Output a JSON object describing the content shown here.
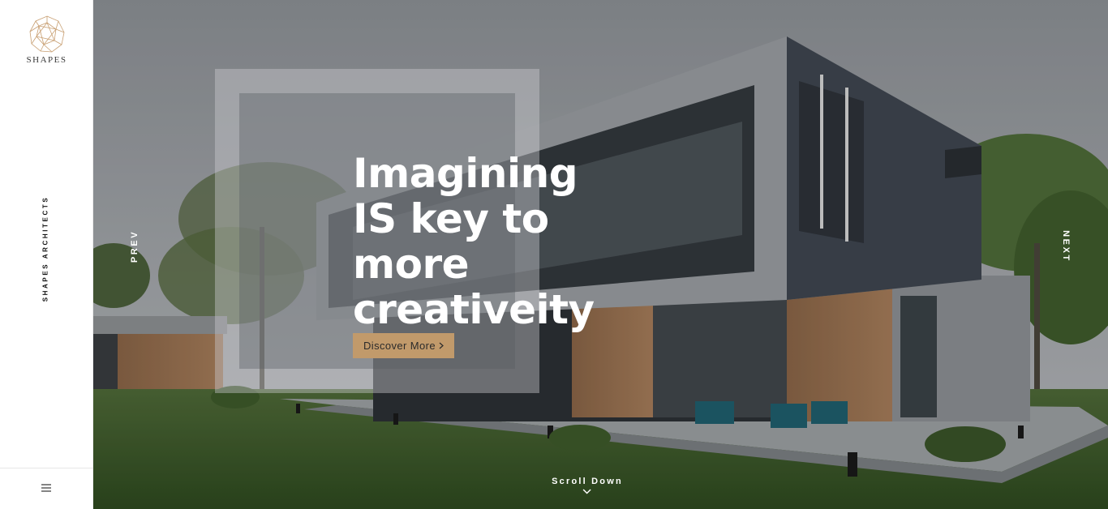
{
  "brand": {
    "logo_icon": "polyhedron-icon",
    "name": "SHAPES",
    "tagline": "SHAPES ARCHITECTS",
    "accent_color": "#c19a6b"
  },
  "sidebar": {
    "menu_icon": "hamburger-menu-icon"
  },
  "hero": {
    "headline": [
      "Imagining",
      "IS key to",
      "more",
      "creativeity"
    ],
    "cta_label": "Discover More",
    "cta_icon": "chevron-right-icon",
    "prev_label": "PREV",
    "next_label": "NEXT",
    "scroll_label": "Scroll Down",
    "scroll_icon": "chevron-down-icon"
  }
}
